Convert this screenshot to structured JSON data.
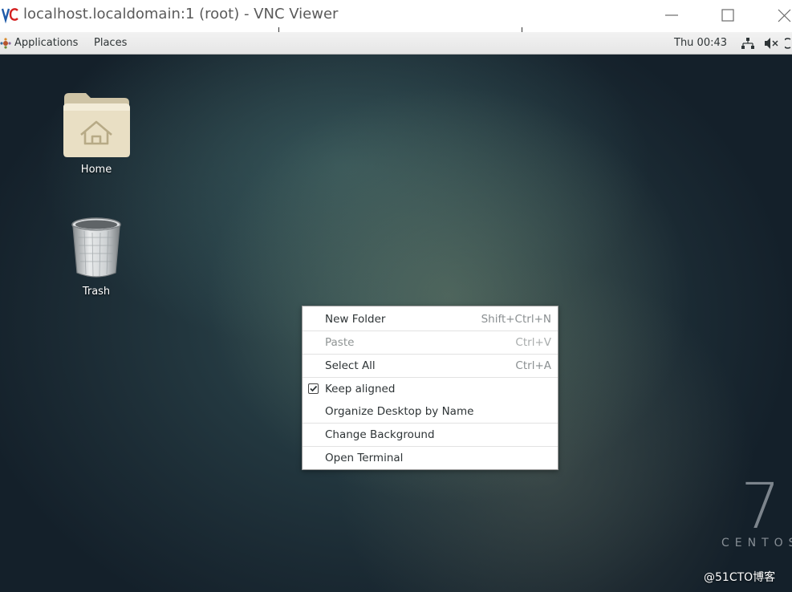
{
  "window": {
    "title": "localhost.localdomain:1 (root) - VNC Viewer",
    "logo_icon": "vnc-viewer-logo",
    "controls": [
      "minimize-icon",
      "maximize-icon",
      "close-icon"
    ]
  },
  "panel": {
    "applications_label": "Applications",
    "places_label": "Places",
    "clock": "Thu 00:43",
    "status_icons": [
      "network-icon",
      "volume-muted-icon",
      "power-icon"
    ]
  },
  "desktop": {
    "icons": [
      {
        "label": "Home",
        "icon": "home-folder-icon"
      },
      {
        "label": "Trash",
        "icon": "trash-icon"
      }
    ],
    "centos_number": "7",
    "centos_word": "CENTOS",
    "watermark": "@51CTO博客"
  },
  "context_menu": {
    "items": [
      {
        "label": "New Folder",
        "accel": "Shift+Ctrl+N",
        "enabled": true
      },
      {
        "label": "Paste",
        "accel": "Ctrl+V",
        "enabled": false
      },
      {
        "label": "Select All",
        "accel": "Ctrl+A",
        "enabled": true
      },
      {
        "label": "Keep aligned",
        "accel": "",
        "enabled": true,
        "checked": true
      },
      {
        "label": "Organize Desktop by Name",
        "accel": "",
        "enabled": true
      },
      {
        "label": "Change Background",
        "accel": "",
        "enabled": true
      },
      {
        "label": "Open Terminal",
        "accel": "",
        "enabled": true
      }
    ]
  },
  "colors": {
    "desktop_dark": "#1c2c35",
    "panel_bg": "#e6e6e6",
    "menu_bg": "#ffffff"
  }
}
